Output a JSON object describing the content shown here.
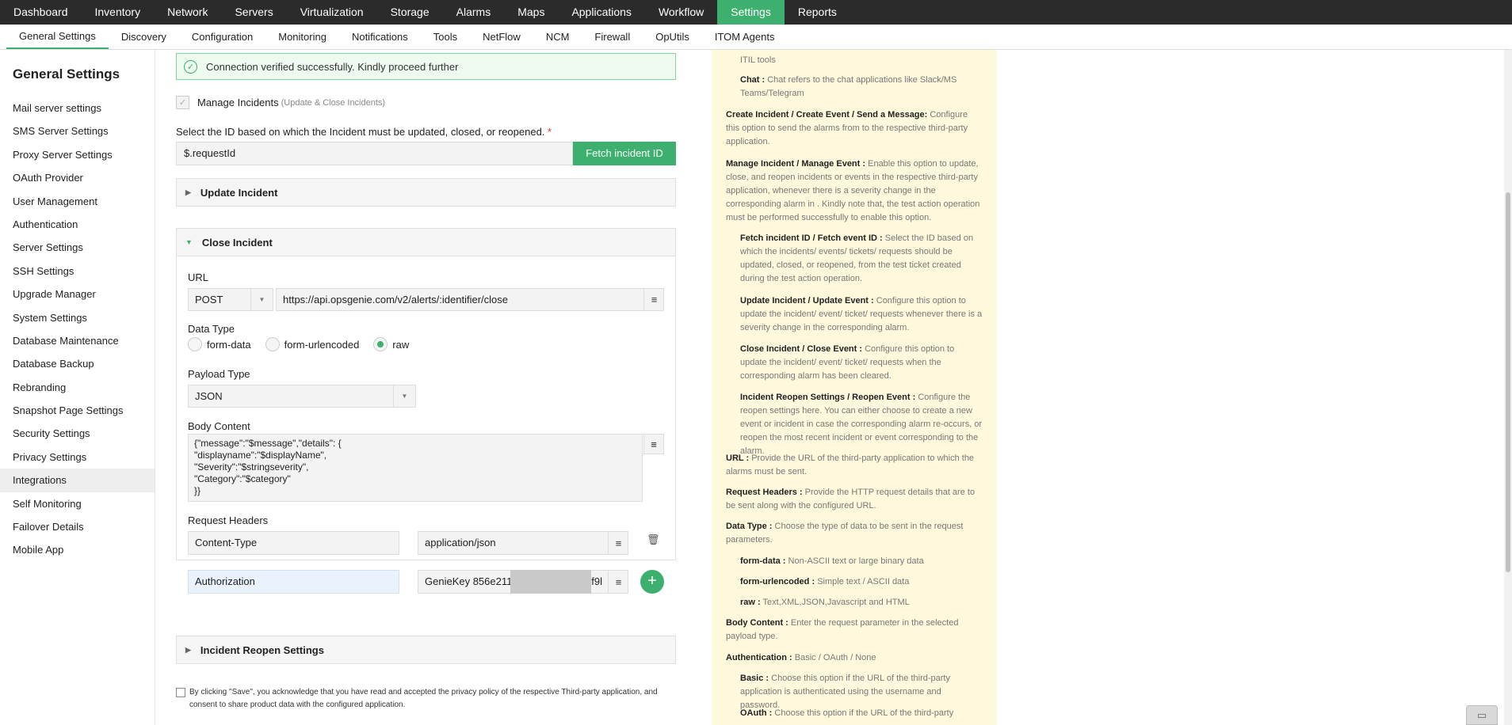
{
  "topnav": {
    "items": [
      "Dashboard",
      "Inventory",
      "Network",
      "Servers",
      "Virtualization",
      "Storage",
      "Alarms",
      "Maps",
      "Applications",
      "Workflow",
      "Settings",
      "Reports"
    ],
    "active": "Settings"
  },
  "subnav": {
    "items": [
      "General Settings",
      "Discovery",
      "Configuration",
      "Monitoring",
      "Notifications",
      "Tools",
      "NetFlow",
      "NCM",
      "Firewall",
      "OpUtils",
      "ITOM Agents"
    ],
    "active": "General Settings"
  },
  "sidebar": {
    "title": "General Settings",
    "items": [
      "Mail server settings",
      "SMS Server Settings",
      "Proxy Server Settings",
      "OAuth Provider",
      "User Management",
      "Authentication",
      "Server Settings",
      "SSH Settings",
      "Upgrade Manager",
      "System Settings",
      "Database Maintenance",
      "Database Backup",
      "Rebranding",
      "Snapshot Page Settings",
      "Security Settings",
      "Privacy Settings",
      "Integrations",
      "Self Monitoring",
      "Failover Details",
      "Mobile App"
    ],
    "active": "Integrations"
  },
  "main": {
    "success_message": "Connection verified successfully. Kindly proceed further",
    "manage_incidents_label": "Manage Incidents",
    "manage_incidents_hint": "(Update & Close Incidents)",
    "select_id_label": "Select the ID based on which the Incident must be updated, closed, or reopened.",
    "required_mark": "*",
    "request_id_value": "$.requestId",
    "fetch_button": "Fetch incident ID",
    "update_incident": "Update Incident",
    "close_incident": "Close Incident",
    "incident_reopen": "Incident Reopen Settings",
    "url_label": "URL",
    "method": "POST",
    "url_value": "https://api.opsgenie.com/v2/alerts/:identifier/close",
    "data_type_label": "Data Type",
    "data_types": [
      "form-data",
      "form-urlencoded",
      "raw"
    ],
    "data_type_selected": "raw",
    "payload_type_label": "Payload Type",
    "payload_type": "JSON",
    "body_content_label": "Body Content",
    "body_content": "{\"message\":\"$message\",\"details\": {\n\"displayname\":\"$displayName\",\n\"Severity\":\"$stringseverity\",\n\"Category\":\"$category\"\n}}",
    "request_headers_label": "Request Headers",
    "headers": [
      {
        "key": "Content-Type",
        "value": "application/json"
      },
      {
        "key": "Authorization",
        "value": "GenieKey 856e211",
        "value_tail": "f9l"
      }
    ],
    "consent_text": "By clicking \"Save\", you acknowledge that you have read and accepted the privacy policy of the respective Third-party application, and consent to share product data with the configured application."
  },
  "help": {
    "itil_tail": "ITIL tools",
    "chat_term": "Chat :",
    "chat_desc": "Chat refers to the chat applications like Slack/MS Teams/Telegram",
    "create_term": "Create Incident / Create Event / Send a Message:",
    "create_desc": "Configure this option to send the alarms from  to the respective third-party application.",
    "manage_term": "Manage Incident / Manage Event :",
    "manage_desc": "Enable this option to update, close, and reopen incidents or events in the respective third-party application, whenever there is a severity change in the corresponding alarm in . Kindly note that, the test action operation must be performed successfully to enable this option.",
    "fetch_term": "Fetch incident ID / Fetch event ID :",
    "fetch_desc": "Select the ID based on which the incidents/ events/ tickets/ requests should be updated, closed, or reopened, from the test ticket created during the test action operation.",
    "update_term": "Update Incident / Update Event :",
    "update_desc": "Configure this option to update the incident/ event/ ticket/ requests whenever there is a severity change in the corresponding alarm.",
    "close_term": "Close Incident / Close Event :",
    "close_desc": "Configure this option to update the incident/ event/ ticket/ requests when the corresponding alarm has been cleared.",
    "reopen_term": "Incident Reopen Settings / Reopen Event :",
    "reopen_desc": "Configure the reopen settings here. You can either choose to create a new event or incident in case the corresponding alarm re-occurs, or reopen the most recent incident or event corresponding to the alarm.",
    "url_term": "URL :",
    "url_desc": " Provide the URL of the third-party application to which the alarms must be sent.",
    "headers_term": "Request Headers :",
    "headers_desc": " Provide the HTTP request details that are to be sent along with the configured URL.",
    "datatype_term": "Data Type :",
    "datatype_desc": "Choose the type of data to be sent in the request parameters.",
    "formdata_term": "form-data :",
    "formdata_desc": "Non-ASCII text or large binary data",
    "urlenc_term": "form-urlencoded :",
    "urlenc_desc": "Simple text / ASCII data",
    "raw_term": "raw :",
    "raw_desc": "Text,XML,JSON,Javascript and HTML",
    "body_term": "Body Content :",
    "body_desc": "Enter the request parameter in the selected payload type.",
    "auth_term": "Authentication :",
    "auth_desc": "Basic / OAuth / None",
    "basic_term": "Basic :",
    "basic_desc": "Choose this option if the URL of the third-party application is authenticated using the username and password.",
    "oauth_term": "OAuth :",
    "oauth_desc": "Choose this option if the URL of the third-party"
  },
  "colors": {
    "accent": "#3daf6e",
    "topbar": "#2b2b2b",
    "help_bg": "#fef9dc"
  }
}
